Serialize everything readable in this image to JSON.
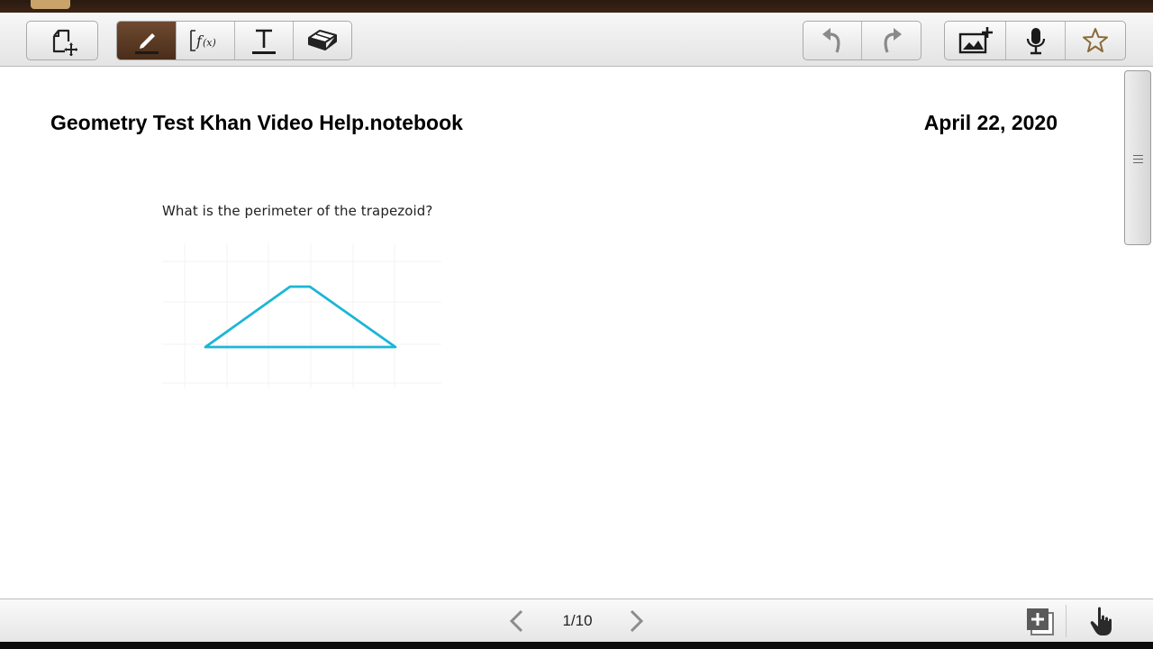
{
  "toolbar": {
    "left_group": [
      {
        "icon": "page-sorter-icon"
      }
    ],
    "tools_group": [
      {
        "icon": "pen-icon",
        "active": true
      },
      {
        "icon": "function-icon",
        "active": false
      },
      {
        "icon": "text-tool-icon",
        "active": false
      },
      {
        "icon": "eraser-icon",
        "active": false
      }
    ],
    "history_group": [
      {
        "icon": "undo-icon"
      },
      {
        "icon": "redo-icon"
      }
    ],
    "insert_group": [
      {
        "icon": "insert-image-icon"
      },
      {
        "icon": "microphone-icon"
      },
      {
        "icon": "favorite-star-icon"
      }
    ],
    "active_color": "#5a3820"
  },
  "page": {
    "title": "Geometry Test Khan Video Help.notebook",
    "date": "April 22, 2020",
    "question": "What is the perimeter of the trapezoid?",
    "figure": {
      "shape": "trapezoid",
      "stroke_color": "#1bb6d6",
      "grid": true
    }
  },
  "bottombar": {
    "page_counter": "1/10",
    "prev_icon": "chevron-left-icon",
    "next_icon": "chevron-right-icon",
    "add_page_icon": "add-page-icon",
    "hand_icon": "hand-pointer-icon"
  }
}
